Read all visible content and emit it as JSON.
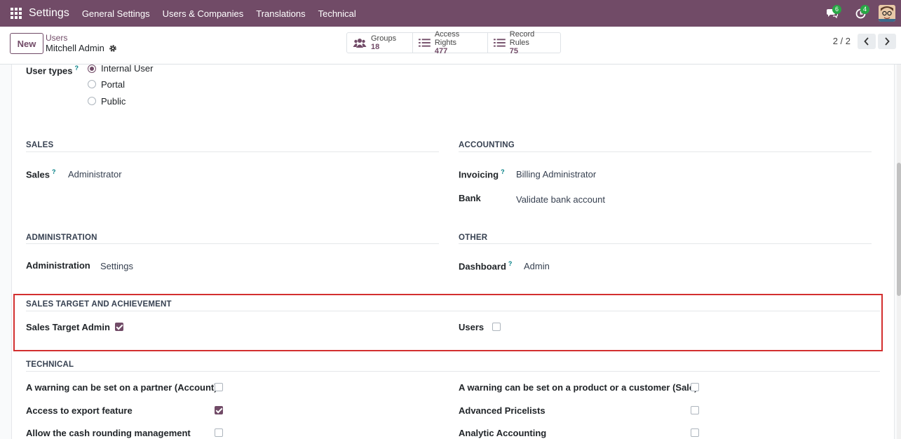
{
  "navbar": {
    "brand": "Settings",
    "menu": [
      "General Settings",
      "Users & Companies",
      "Translations",
      "Technical"
    ],
    "messages_badge": "6",
    "activities_badge": "4"
  },
  "control": {
    "new_label": "New",
    "breadcrumb": "Users",
    "record_title": "Mitchell Admin",
    "stats": [
      {
        "label": "Groups",
        "value": "18",
        "icon": "users-group-icon"
      },
      {
        "label": "Access Rights",
        "value": "477",
        "icon": "list-icon"
      },
      {
        "label": "Record Rules",
        "value": "75",
        "icon": "list-icon"
      }
    ],
    "pager": "2 / 2"
  },
  "form": {
    "user_types": {
      "label": "User types",
      "help": "?",
      "options": [
        "Internal User",
        "Portal",
        "Public"
      ],
      "selected": "Internal User"
    },
    "sales": {
      "title": "SALES",
      "field_label": "Sales",
      "help": "?",
      "value": "Administrator"
    },
    "accounting": {
      "title": "ACCOUNTING",
      "invoicing_label": "Invoicing",
      "help": "?",
      "invoicing_value": "Billing Administrator",
      "bank_label": "Bank",
      "bank_value": "Validate bank account"
    },
    "administration": {
      "title": "ADMINISTRATION",
      "field_label": "Administration",
      "value": "Settings"
    },
    "other": {
      "title": "OTHER",
      "field_label": "Dashboard",
      "help": "?",
      "value": "Admin"
    },
    "sales_target": {
      "title": "SALES TARGET AND ACHIEVEMENT",
      "admin_label": "Sales Target Admin",
      "admin_checked": true,
      "users_label": "Users",
      "users_checked": false
    },
    "technical": {
      "title": "TECHNICAL",
      "left": [
        {
          "label": "A warning can be set on a partner (Account)",
          "checked": false
        },
        {
          "label": "Access to export feature",
          "checked": true
        },
        {
          "label": "Allow the cash rounding management",
          "checked": false
        }
      ],
      "right": [
        {
          "label": "A warning can be set on a product or a customer (Sale)",
          "checked": false
        },
        {
          "label": "Advanced Pricelists",
          "checked": false
        },
        {
          "label": "Analytic Accounting",
          "checked": false
        }
      ]
    }
  },
  "colors": {
    "brand": "#714b67",
    "help": "#017e84",
    "highlight": "#d32f2f"
  }
}
